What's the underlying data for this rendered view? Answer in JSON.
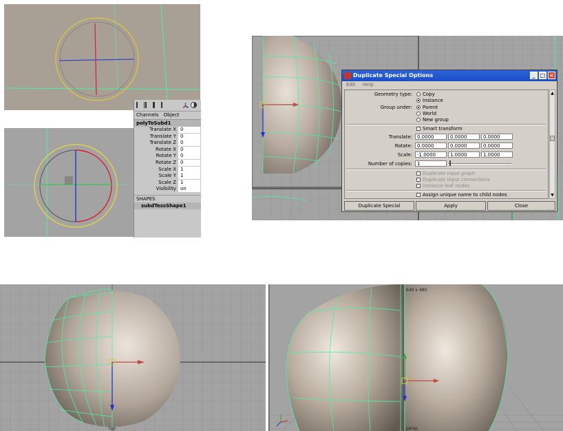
{
  "channel_box": {
    "menu": [
      "Channels",
      "Object"
    ],
    "node_name": "polyToSubd1",
    "attributes": [
      {
        "label": "Translate X",
        "value": "0"
      },
      {
        "label": "Translate Y",
        "value": "0"
      },
      {
        "label": "Translate Z",
        "value": "0"
      },
      {
        "label": "Rotate X",
        "value": "0"
      },
      {
        "label": "Rotate Y",
        "value": "0"
      },
      {
        "label": "Rotate Z",
        "value": "0"
      },
      {
        "label": "Scale X",
        "value": "1"
      },
      {
        "label": "Scale Y",
        "value": "1"
      },
      {
        "label": "Scale Z",
        "value": "1"
      },
      {
        "label": "Visibility",
        "value": "on"
      }
    ],
    "shapes_header": "SHAPES",
    "shape_node": "subdTessShape1"
  },
  "dialog": {
    "title": "Duplicate Special Options",
    "menu": [
      "Edit",
      "Help"
    ],
    "geometry_type": {
      "label": "Geometry type:",
      "options": [
        "Copy",
        "Instance"
      ],
      "selected": "Instance"
    },
    "group_under": {
      "label": "Group under:",
      "options": [
        "Parent",
        "World",
        "New group"
      ],
      "selected": "Parent"
    },
    "smart_transform": "Smart transform",
    "translate": {
      "label": "Translate:",
      "values": [
        "0.0000",
        "0.0000",
        "0.0000"
      ]
    },
    "rotate": {
      "label": "Rotate:",
      "values": [
        "0.0000",
        "0.0000",
        "0.0000"
      ]
    },
    "scale": {
      "label": "Scale:",
      "values": [
        "-1.0000",
        "1.0000",
        "1.0000"
      ]
    },
    "copies": {
      "label": "Number of copies:",
      "value": "1"
    },
    "disabled_options": [
      "Duplicate input graph",
      "Duplicate input connections",
      "Instance leaf nodes"
    ],
    "assign_unique": "Assign unique name to child nodes",
    "buttons": [
      "Duplicate Special",
      "Apply",
      "Close"
    ]
  },
  "viewport": {
    "resolution_label": "640 x 480",
    "camera_label": "persp",
    "bottom_left_label": "top"
  },
  "colors": {
    "viewport_bg": "#a8a29c",
    "grid_bg": "#a3a3a3",
    "wire": "#4cf0a0",
    "title_bar": "#1f56cc"
  }
}
